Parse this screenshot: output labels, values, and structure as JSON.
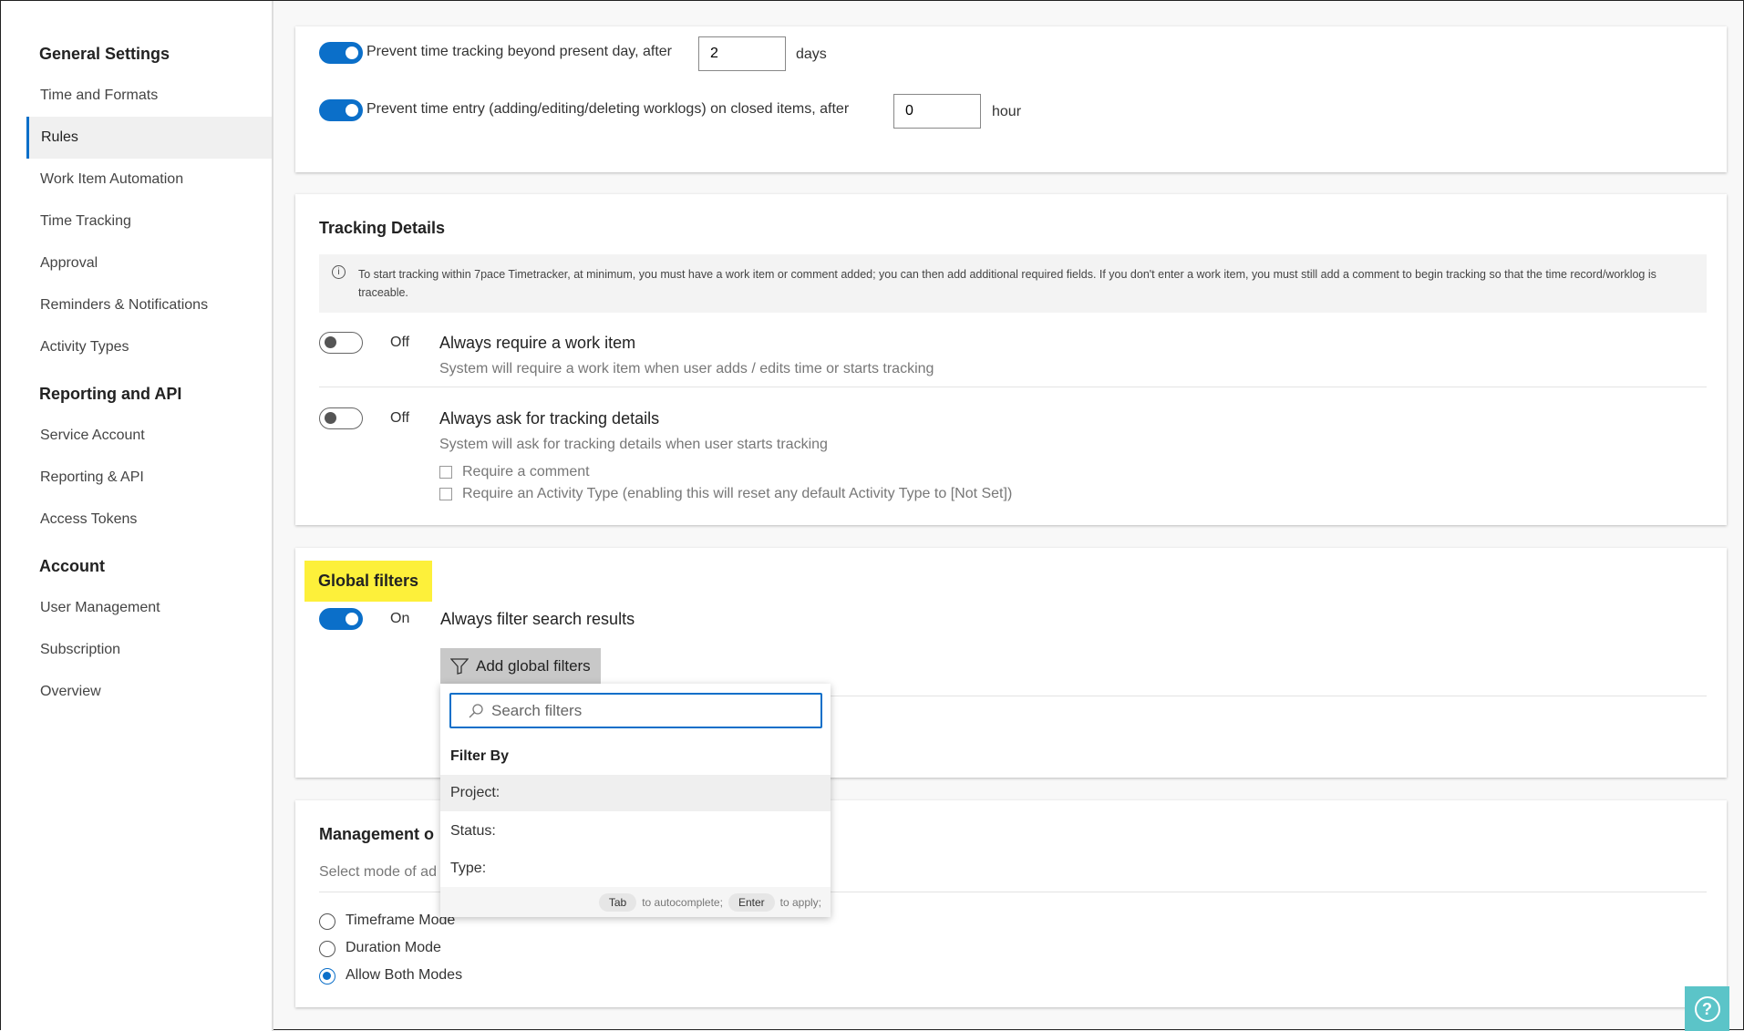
{
  "sidebar": {
    "sections": [
      {
        "title": "General Settings",
        "items": [
          "Time and Formats",
          "Rules",
          "Work Item Automation",
          "Time Tracking",
          "Approval",
          "Reminders & Notifications",
          "Activity Types"
        ]
      },
      {
        "title": "Reporting and API",
        "items": [
          "Service Account",
          "Reporting & API",
          "Access Tokens"
        ]
      },
      {
        "title": "Account",
        "items": [
          "User Management",
          "Subscription",
          "Overview"
        ]
      }
    ],
    "active": "Rules"
  },
  "rules": {
    "prevent_future": {
      "label": "Prevent time tracking beyond present day, after",
      "value": "2",
      "unit": "days",
      "state": "on"
    },
    "prevent_closed": {
      "label": "Prevent time entry (adding/editing/deleting worklogs) on closed items, after",
      "value": "0",
      "unit": "hour",
      "state": "on"
    }
  },
  "tracking": {
    "title": "Tracking Details",
    "info": "To start tracking within 7pace Timetracker, at minimum, you must have a work item or comment added; you can then add additional required fields. If you don't enter a work item, you must still add a comment to begin tracking so that the time record/worklog is traceable.",
    "work_item": {
      "state": "Off",
      "title": "Always require a work item",
      "desc": "System will require a work item when user adds / edits time or starts tracking"
    },
    "details": {
      "state": "Off",
      "title": "Always ask for tracking details",
      "desc": "System will ask for tracking details when user starts tracking",
      "options": [
        "Require a comment",
        "Require an Activity Type (enabling this will reset any default Activity Type to [Not Set])"
      ]
    }
  },
  "global_filters": {
    "title": "Global filters",
    "highlight": "#fdf03a",
    "state": "On",
    "title2": "Always filter search results",
    "button": "Add global filters",
    "dropdown": {
      "placeholder": "Search filters",
      "header": "Filter By",
      "items": [
        "Project:",
        "Status:",
        "Type:"
      ],
      "hint": {
        "key1": "Tab",
        "text1": "to autocomplete;",
        "key2": "Enter",
        "text2": "to apply;"
      }
    }
  },
  "management": {
    "title": "Management o",
    "desc": "Select mode of ad",
    "modes": [
      "Timeframe Mode",
      "Duration Mode",
      "Allow Both Modes"
    ],
    "selected": "Allow Both Modes"
  },
  "accent": "#0b6fc9"
}
